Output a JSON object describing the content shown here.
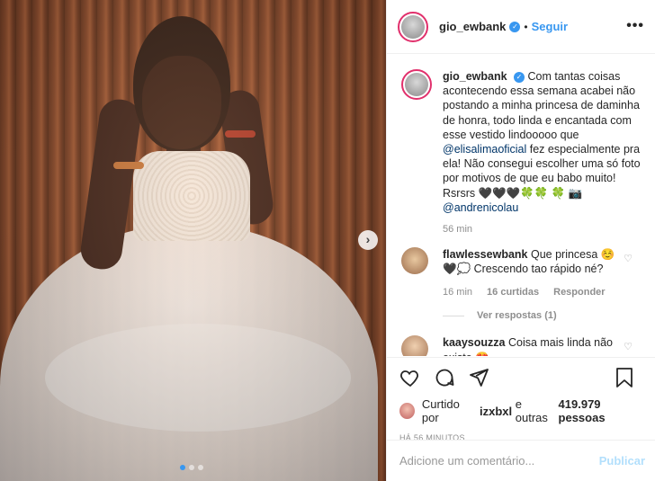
{
  "post": {
    "username": "gio_ewbank",
    "follow_label": "Seguir",
    "more_icon": "more-options-icon",
    "verified_icon": "verified-badge-icon"
  },
  "caption": {
    "username": "gio_ewbank",
    "text_before": "Com tantas coisas acontecendo essa semana acabei não postando a minha princesa de daminha de honra, todo linda e encantada com esse vestido lindooooo que ",
    "mention1": "@elisalimaoficial",
    "text_after": " fez especialmente pra ela! Não consegui escolher uma só foto por motivos de que eu babo muito! Rsrsrs 🖤🖤🖤🍀🍀 🍀 📷 ",
    "mention2": "@andrenicolau",
    "time": "56 min"
  },
  "comments": [
    {
      "username": "flawlessewbank",
      "text": "Que princesa ☺️ 🖤💭 Crescendo tao rápido né?",
      "time": "16 min",
      "likes": "16 curtidas",
      "reply": "Responder",
      "view_replies": "Ver respostas (1)"
    },
    {
      "username": "kaaysouzza",
      "text": "Coisa mais linda não existe 😍"
    }
  ],
  "likes": {
    "prefix": "Curtido por",
    "user": "izxbxl",
    "middle": "e outras",
    "count": "419.979 pessoas",
    "ago": "HÁ 56 MINUTOS"
  },
  "comment_box": {
    "placeholder": "Adicione um comentário...",
    "publish": "Publicar"
  },
  "carousel": {
    "slides": 3,
    "active": 1,
    "next_icon": "chevron-right-icon"
  },
  "colors": {
    "accent": "#3897f0",
    "link": "#003569",
    "muted": "#8e8e8e",
    "publish_disabled": "#b2dffc"
  }
}
